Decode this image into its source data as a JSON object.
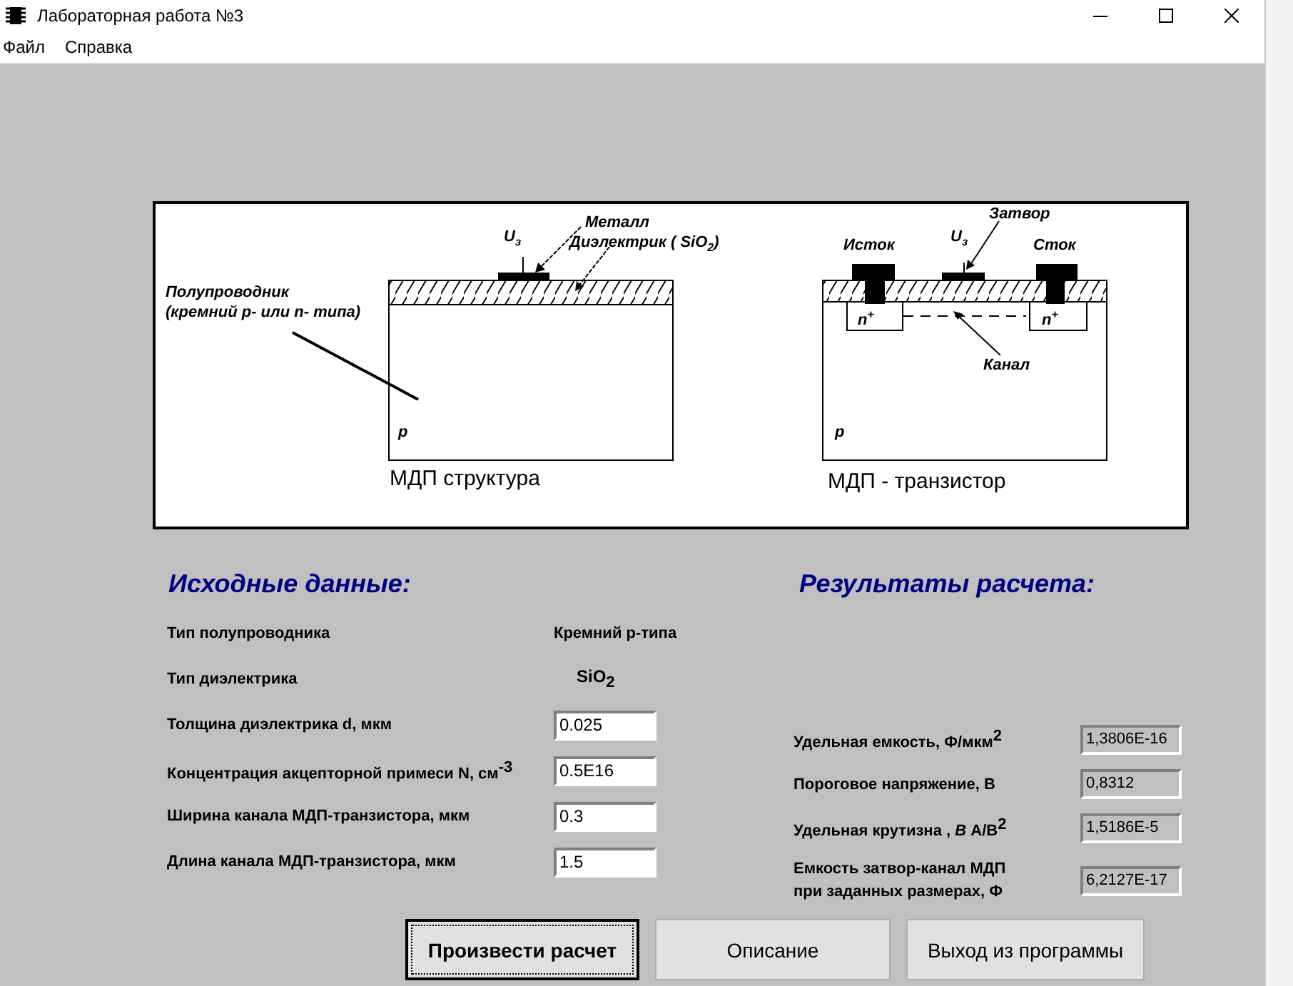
{
  "window": {
    "title": "Лабораторная работа №3"
  },
  "menu": [
    "Файл",
    "Справка"
  ],
  "diagram": {
    "structure": {
      "gate": "U$_{з}$",
      "metal": "Металл",
      "dielectric": "Диэлектрик ( SiO$_{2}$)",
      "semiconductor": "Полупроводник",
      "semiconductor_note": "(кремний p- или n- типа)",
      "substrate": "p",
      "caption": "МДП структура"
    },
    "transistor": {
      "gate_label": "Затвор",
      "source": "Исток",
      "gate": "U$_{з}$",
      "drain": "Сток",
      "source_region": "n$^{+}$",
      "drain_region": "n$^{+}$",
      "channel": "Канал",
      "substrate": "p",
      "caption": "МДП - транзистор"
    }
  },
  "source_data": {
    "title": "Исходные данные:",
    "rows": [
      {
        "kind": "text",
        "label": "Тип полупроводника",
        "value": "Кремний p-типа"
      },
      {
        "kind": "formula",
        "label": "Тип диэлектрика",
        "value": "SiO$_{2}$"
      },
      {
        "kind": "input",
        "label": "Толщина диэлектрика d, мкм",
        "value": "0.025"
      },
      {
        "kind": "input",
        "label": "Концентрация акцепторной примеси N, см$^{-3}$",
        "value": "0.5E16"
      },
      {
        "kind": "input",
        "label": "Ширина канала МДП-транзистора, мкм",
        "value": "0.3"
      },
      {
        "kind": "input",
        "label": "Длина канала МДП-транзистора, мкм",
        "value": "1.5"
      }
    ]
  },
  "results": {
    "title": "Результаты расчета:",
    "rows": [
      {
        "label": "Удельная емкость, Ф/мкм$^{2}$",
        "value": "1,3806E-16"
      },
      {
        "label": "Пороговое напряжение, В",
        "value": "0,8312"
      },
      {
        "label": "Удельная крутизна ,  *B*  А/В$^{2}$",
        "value": "1,5186E-5"
      },
      {
        "label": "Емкость затвор-канал МДП\nпри заданных размерах, Ф",
        "value": "6,2127E-17"
      }
    ]
  },
  "buttons": [
    {
      "label": "Произвести расчет",
      "default": true
    },
    {
      "label": "Описание",
      "default": false
    },
    {
      "label": "Выход из программы",
      "default": false
    }
  ]
}
